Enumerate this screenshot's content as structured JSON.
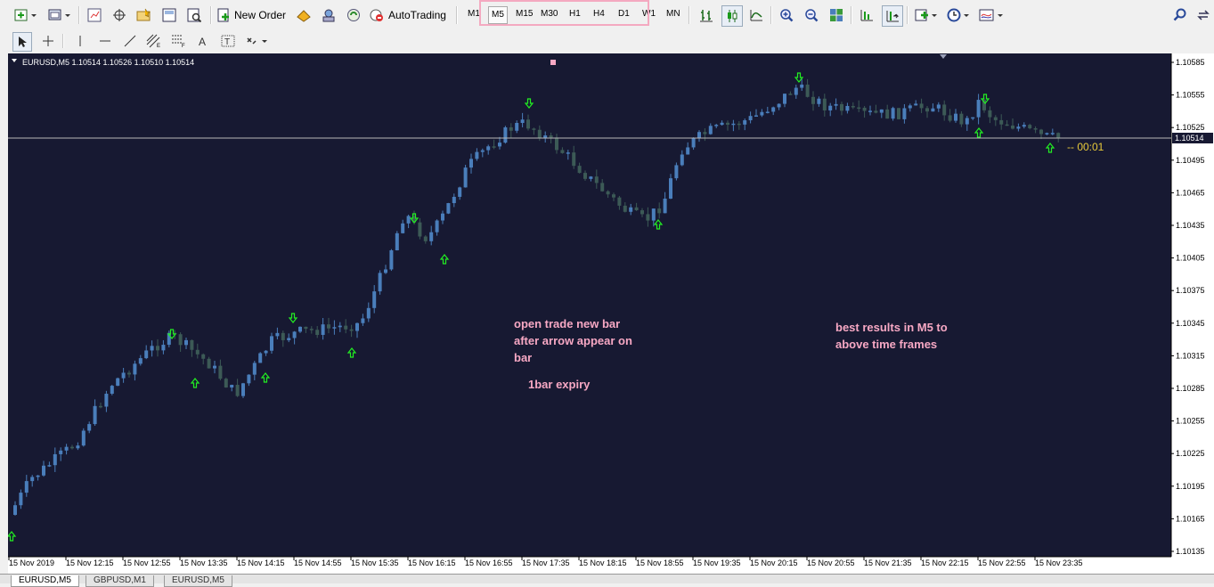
{
  "toolbar": {
    "new_order": "New Order",
    "autotrading": "AutoTrading",
    "timeframes": [
      "M1",
      "M5",
      "M15",
      "M30",
      "H1",
      "H4",
      "D1",
      "W1",
      "MN"
    ],
    "active_timeframe": "M5"
  },
  "chart": {
    "header": "EURUSD,M5  1.10514 1.10526 1.10510 1.10514",
    "background": "#171932",
    "bull_color": "#4a7ebb",
    "bear_color": "#3c5a56",
    "arrow_color": "#22ee22",
    "current_price": "1.10514",
    "timer": "-- 00:01",
    "price_axis": [
      "1.10585",
      "1.10555",
      "1.10525",
      "1.10495",
      "1.10465",
      "1.10435",
      "1.10405",
      "1.10375",
      "1.10345",
      "1.10315",
      "1.10285",
      "1.10255",
      "1.10225",
      "1.10195",
      "1.10165",
      "1.10135"
    ],
    "time_axis": [
      "15 Nov 2019",
      "15 Nov 12:15",
      "15 Nov 12:55",
      "15 Nov 13:35",
      "15 Nov 14:15",
      "15 Nov 14:55",
      "15 Nov 15:35",
      "15 Nov 16:15",
      "15 Nov 16:55",
      "15 Nov 17:35",
      "15 Nov 18:15",
      "15 Nov 18:55",
      "15 Nov 19:35",
      "15 Nov 20:15",
      "15 Nov 20:55",
      "15 Nov 21:35",
      "15 Nov 22:15",
      "15 Nov 22:55",
      "15 Nov 23:35"
    ],
    "annotations": {
      "note1_line1": "open trade new bar",
      "note1_line2": "after arrow appear on",
      "note1_line3": "bar",
      "note2": "1bar expiry",
      "note3_line1": "best results in M5 to",
      "note3_line2": "above time frames"
    },
    "annotation_color": "#f7a8c4"
  },
  "tabs": [
    "EURUSD,M5",
    "GBPUSD,M1",
    "EURUSD,M5"
  ]
}
